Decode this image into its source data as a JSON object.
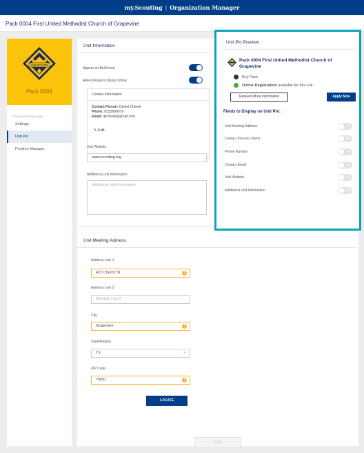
{
  "topbar": {
    "brand": "my.Scouting",
    "separator": "|",
    "app": "Organization Manager"
  },
  "page_title": "Pack 0004 First United Methodist Church of Grapevine",
  "sidebar": {
    "unit_name": "Pack 0004",
    "logo_text": "CUB SCOUTS",
    "section_label": "Organization Manager",
    "items": [
      {
        "label": "Settings",
        "active": false
      },
      {
        "label": "Unit Pin",
        "active": true
      },
      {
        "label": "Position Manager",
        "active": false
      }
    ]
  },
  "unit_info": {
    "title": "Unit Information",
    "appear_label": "Appear on BeAScout",
    "appear_on": true,
    "apply_label": "Allow People to Apply Online",
    "apply_on": true,
    "contact_title": "Contact Information",
    "contact_person_label": "Contact Person:",
    "contact_person": "Daniel Cherek",
    "phone_label": "Phone:",
    "phone": "8325999079",
    "email_label": "Email:",
    "email": "djcherek@gmail.com",
    "edit_label": "Edit",
    "website_label": "Unit Website",
    "website_value": "www.scouting.org",
    "additional_label": "Additional Unit Information",
    "additional_placeholder": "Additional Unit Information"
  },
  "address": {
    "title": "Unit Meeting Address",
    "line1_label": "Address Line 1",
    "line1_value": "422 Church St",
    "line2_label": "Address Line 2",
    "line2_placeholder": "Address Line 2",
    "city_label": "City",
    "city_value": "Grapevine",
    "state_label": "State/Region",
    "state_value": "TX",
    "zip_label": "ZIP Code",
    "zip_value": "76051",
    "locate_label": "LOCATE",
    "save_label": "SAVE"
  },
  "preview": {
    "title": "Unit Pin Preview",
    "unit_name": "Pack 0004 First United Methodist Church of Grapevine",
    "type_label": "Boy Pack",
    "online_bold": "Online Registration",
    "online_rest": "available for this unit.",
    "request_label": "Request More Information",
    "apply_label": "Apply Now",
    "fields_title": "Fields to Display on Unit Pin:",
    "fields": [
      {
        "label": "Unit Meeting Address",
        "on": false
      },
      {
        "label": "Contact Persons Name",
        "on": false
      },
      {
        "label": "Phone Number",
        "on": false
      },
      {
        "label": "Contact Email",
        "on": false
      },
      {
        "label": "Unit Website",
        "on": false
      },
      {
        "label": "Additional Unit Information",
        "on": false
      }
    ]
  },
  "colors": {
    "brand_blue": "#003f87",
    "cub_yellow": "#fcc30b",
    "highlight_teal": "#0aa2b5",
    "warning_orange": "#f0b63c",
    "online_green": "#44a832"
  },
  "icons": [
    "cub-scouts-logo",
    "toggle-switch",
    "pencil-icon",
    "warning-icon",
    "cub-scouts-small-icon",
    "dark-dot-icon",
    "green-dot-icon"
  ]
}
